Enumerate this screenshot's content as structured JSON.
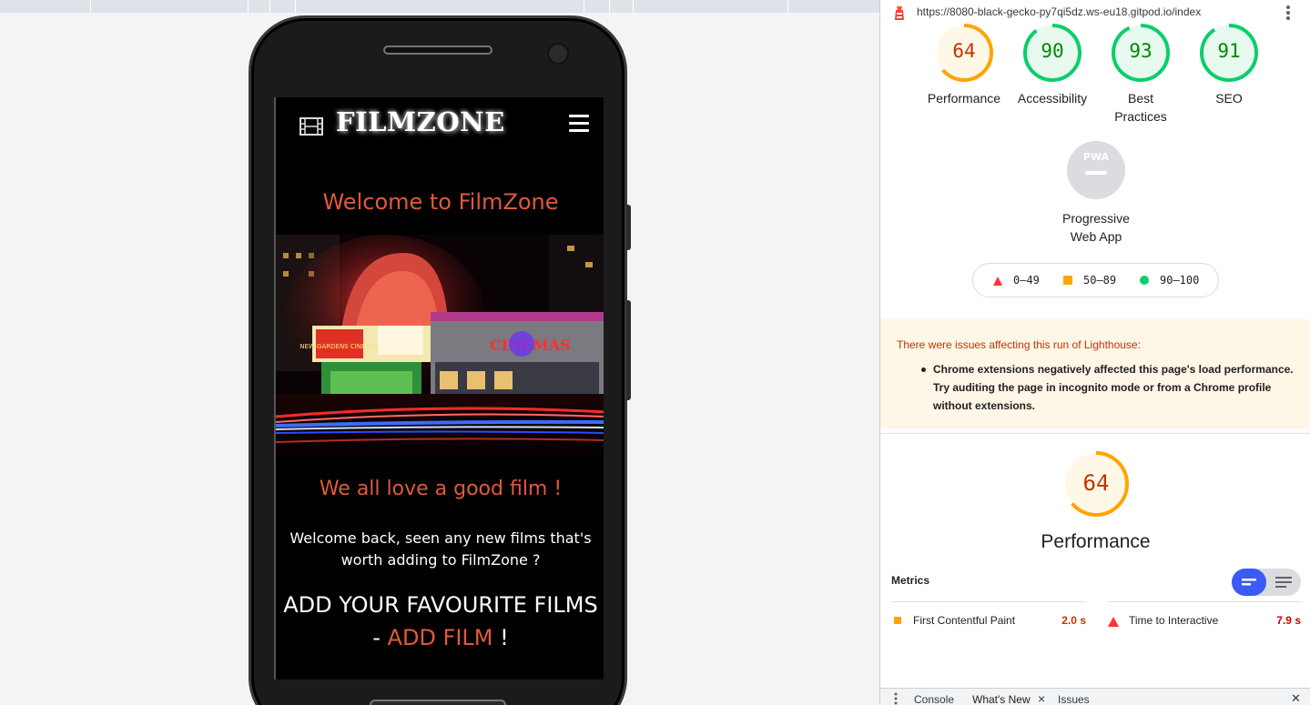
{
  "device": {
    "brand": "FILMZONE",
    "welcome": "Welcome to FilmZone",
    "tagline": "We all love a good film !",
    "intro": "Welcome back, seen any new films that's worth adding to FilmZone ?",
    "cta_prefix": "ADD YOUR FAVOURITE FILMS - ",
    "cta_link": "ADD FILM",
    "cta_suffix": " !",
    "hero_sign_left": "NEW GARDENS CINEMAS",
    "hero_sign_right": "CINEMAS",
    "icons": [
      "film-icon",
      "hamburger-menu-icon"
    ]
  },
  "lighthouse": {
    "url": "https://8080-black-gecko-py7qi5dz.ws-eu18.gitpod.io/index",
    "scores": [
      {
        "label": "Performance",
        "value": 64,
        "color": "#ffa400"
      },
      {
        "label": "Accessibility",
        "value": 90,
        "color": "#0cce6b"
      },
      {
        "label_line1": "Best",
        "label_line2": "Practices",
        "value": 93,
        "color": "#0cce6b"
      },
      {
        "label": "SEO",
        "value": 91,
        "color": "#0cce6b"
      }
    ],
    "pwa": {
      "badge": "PWA",
      "label_line1": "Progressive",
      "label_line2": "Web App"
    },
    "legend": [
      {
        "range": "0–49",
        "color": "#ff3333"
      },
      {
        "range": "50–89",
        "color": "#ffa400"
      },
      {
        "range": "90–100",
        "color": "#0cce6b"
      }
    ],
    "warning": {
      "title": "There were issues affecting this run of Lighthouse:",
      "item": "Chrome extensions negatively affected this page's load performance. Try auditing the page in incognito mode or from a Chrome profile without extensions."
    },
    "performance": {
      "value": 64,
      "title": "Performance"
    },
    "metrics_label": "Metrics",
    "metrics": [
      {
        "name": "First Contentful Paint",
        "value": "2.0 s",
        "color": "#ffa400",
        "value_color": "#c33300"
      },
      {
        "name": "Time to Interactive",
        "value": "7.9 s",
        "color": "#ff3333",
        "value_color": "#cc0000"
      }
    ],
    "drawer": {
      "console": "Console",
      "whats_new": "What's New",
      "close": "×",
      "issues": "Issues",
      "drawer_close": "✕"
    }
  }
}
